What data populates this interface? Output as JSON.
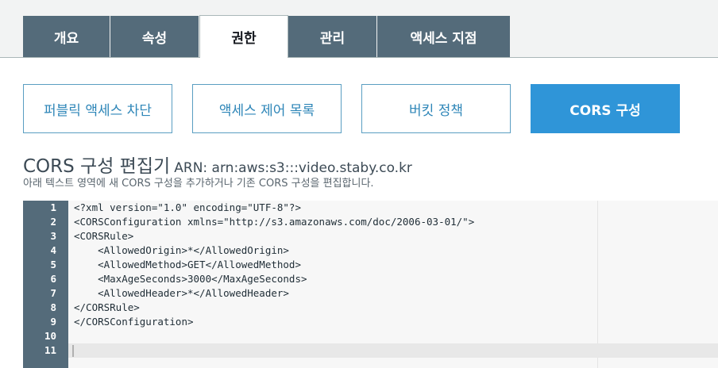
{
  "top_tabs": [
    {
      "label": "개요",
      "active": false
    },
    {
      "label": "속성",
      "active": false
    },
    {
      "label": "권한",
      "active": true
    },
    {
      "label": "관리",
      "active": false
    },
    {
      "label": "액세스 지점",
      "active": false
    }
  ],
  "sub_tabs": [
    {
      "label": "퍼블릭 액세스 차단",
      "active": false
    },
    {
      "label": "액세스 제어 목록",
      "active": false
    },
    {
      "label": "버킷 정책",
      "active": false
    },
    {
      "label": "CORS 구성",
      "active": true
    }
  ],
  "editor_section": {
    "title": "CORS 구성 편집기",
    "arn": "ARN: arn:aws:s3:::video.staby.co.kr",
    "description": "아래 텍스트 영역에 새 CORS 구성을 추가하거나 기존 CORS 구성을 편집합니다."
  },
  "code": {
    "line_numbers": [
      "1",
      "2",
      "3",
      "4",
      "5",
      "6",
      "7",
      "8",
      "9",
      "10",
      "11"
    ],
    "lines": [
      "<?xml version=\"1.0\" encoding=\"UTF-8\"?>",
      "<CORSConfiguration xmlns=\"http://s3.amazonaws.com/doc/2006-03-01/\">",
      "<CORSRule>",
      "    <AllowedOrigin>*</AllowedOrigin>",
      "    <AllowedMethod>GET</AllowedMethod>",
      "    <MaxAgeSeconds>3000</MaxAgeSeconds>",
      "    <AllowedHeader>*</AllowedHeader>",
      "</CORSRule>",
      "</CORSConfiguration>",
      "",
      ""
    ]
  },
  "colors": {
    "tab_bg": "#546b7a",
    "accent": "#2f95d8",
    "link": "#2e86b8"
  }
}
